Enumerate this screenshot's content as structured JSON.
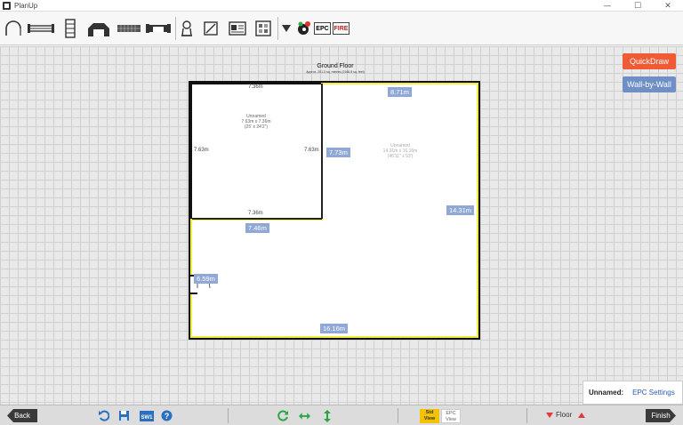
{
  "window": {
    "title": "PlanUp",
    "minimize": "—",
    "maximize": "☐",
    "close": "✕"
  },
  "toolbar": {
    "tools": [
      "arc-wall-icon",
      "window-icon",
      "door-icon",
      "stairs-icon",
      "bay-window-icon",
      "radiator-icon",
      "fireplace-icon",
      "boiler-icon",
      "floor-surface-icon",
      "room-photo-icon",
      "room-properties-icon",
      "dropdown-icon",
      "colour-palette-icon"
    ],
    "epc_label": "EPC",
    "fire_label": "FIRE"
  },
  "canvas": {
    "floor_title": "Ground Floor",
    "floor_subtitle": "Approx. 201.3 sq. metres (2166.8 sq. feet)",
    "quickdraw_label": "QuickDraw",
    "wall_by_wall_label": "Wall-by-Wall",
    "rooms": [
      {
        "name": "Unnamed",
        "size_m": "7.63m x 7.36m",
        "size_ft": "(25' x 24'2\")",
        "dims": {
          "top": "7.36m",
          "bottom": "7.36m",
          "left": "7.63m",
          "right": "7.63m"
        }
      },
      {
        "name": "Unnamed",
        "size_m": "14.31m x 16.16m",
        "size_ft": "(46'11\" x 53')"
      }
    ],
    "wall_tags": {
      "top_right": "8.71m",
      "middle_vertical": "7.73m",
      "right": "14.31m",
      "middle_horizontal": "7.46m",
      "left": "6.59m",
      "bottom": "16.16m"
    }
  },
  "epc_panel": {
    "name": "Unnamed:",
    "settings": "EPC Settings"
  },
  "bottombar": {
    "back_label": "Back",
    "finish_label": "Finish",
    "std_view_line1": "Std",
    "std_view_line2": "View",
    "epc_view_line1": "EPC",
    "epc_view_line2": "View",
    "floor_label": "Floor",
    "sw_label": "SW1"
  },
  "colors": {
    "accent_orange": "#f05a35",
    "accent_blue": "#6f8fc7",
    "wall_highlight": "#f3ef3c",
    "std_view": "#f5c200"
  }
}
